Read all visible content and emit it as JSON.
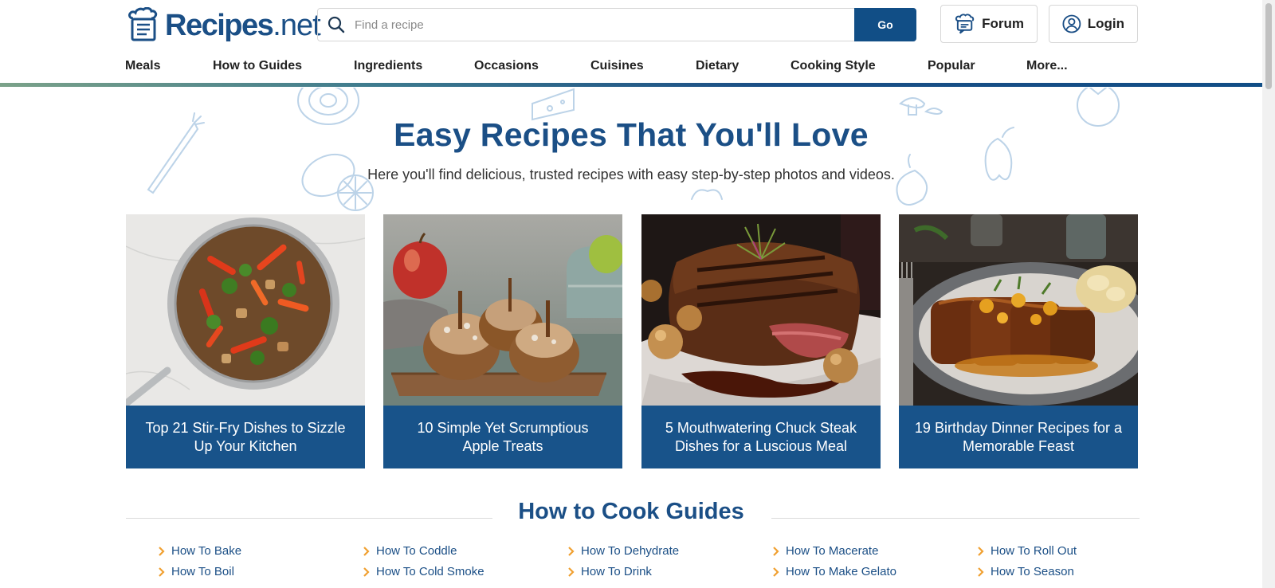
{
  "header": {
    "logo_main": "Recipes",
    "logo_suffix": "net",
    "search_placeholder": "Find a recipe",
    "search_button": "Go",
    "forum_label": "Forum",
    "login_label": "Login"
  },
  "nav": {
    "items": [
      "Meals",
      "How to Guides",
      "Ingredients",
      "Occasions",
      "Cuisines",
      "Dietary",
      "Cooking Style",
      "Popular",
      "More..."
    ]
  },
  "hero": {
    "title": "Easy Recipes That You'll Love",
    "subtitle": "Here you'll find delicious, trusted recipes with easy step-by-step photos and videos."
  },
  "cards": [
    {
      "caption": "Top 21 Stir-Fry Dishes to Sizzle Up Your Kitchen",
      "image": "stir-fry-pan-photo"
    },
    {
      "caption": "10 Simple Yet Scrumptious Apple Treats",
      "image": "baked-apples-photo"
    },
    {
      "caption": "5 Mouthwatering Chuck Steak Dishes for a Luscious Meal",
      "image": "chuck-steak-photo"
    },
    {
      "caption": "19 Birthday Dinner Recipes for a Memorable Feast",
      "image": "glazed-pork-dinner-photo"
    }
  ],
  "guides": {
    "title": "How to Cook Guides",
    "columns": [
      [
        "How To Bake",
        "How To Boil"
      ],
      [
        "How To Coddle",
        "How To Cold Smoke"
      ],
      [
        "How To Dehydrate",
        "How To Drink"
      ],
      [
        "How To Macerate",
        "How To Make Gelato"
      ],
      [
        "How To Roll Out",
        "How To Season"
      ]
    ]
  },
  "colors": {
    "brand_blue": "#1b4f86",
    "caption_blue": "#18538a",
    "chevron_orange": "#f0a030"
  }
}
